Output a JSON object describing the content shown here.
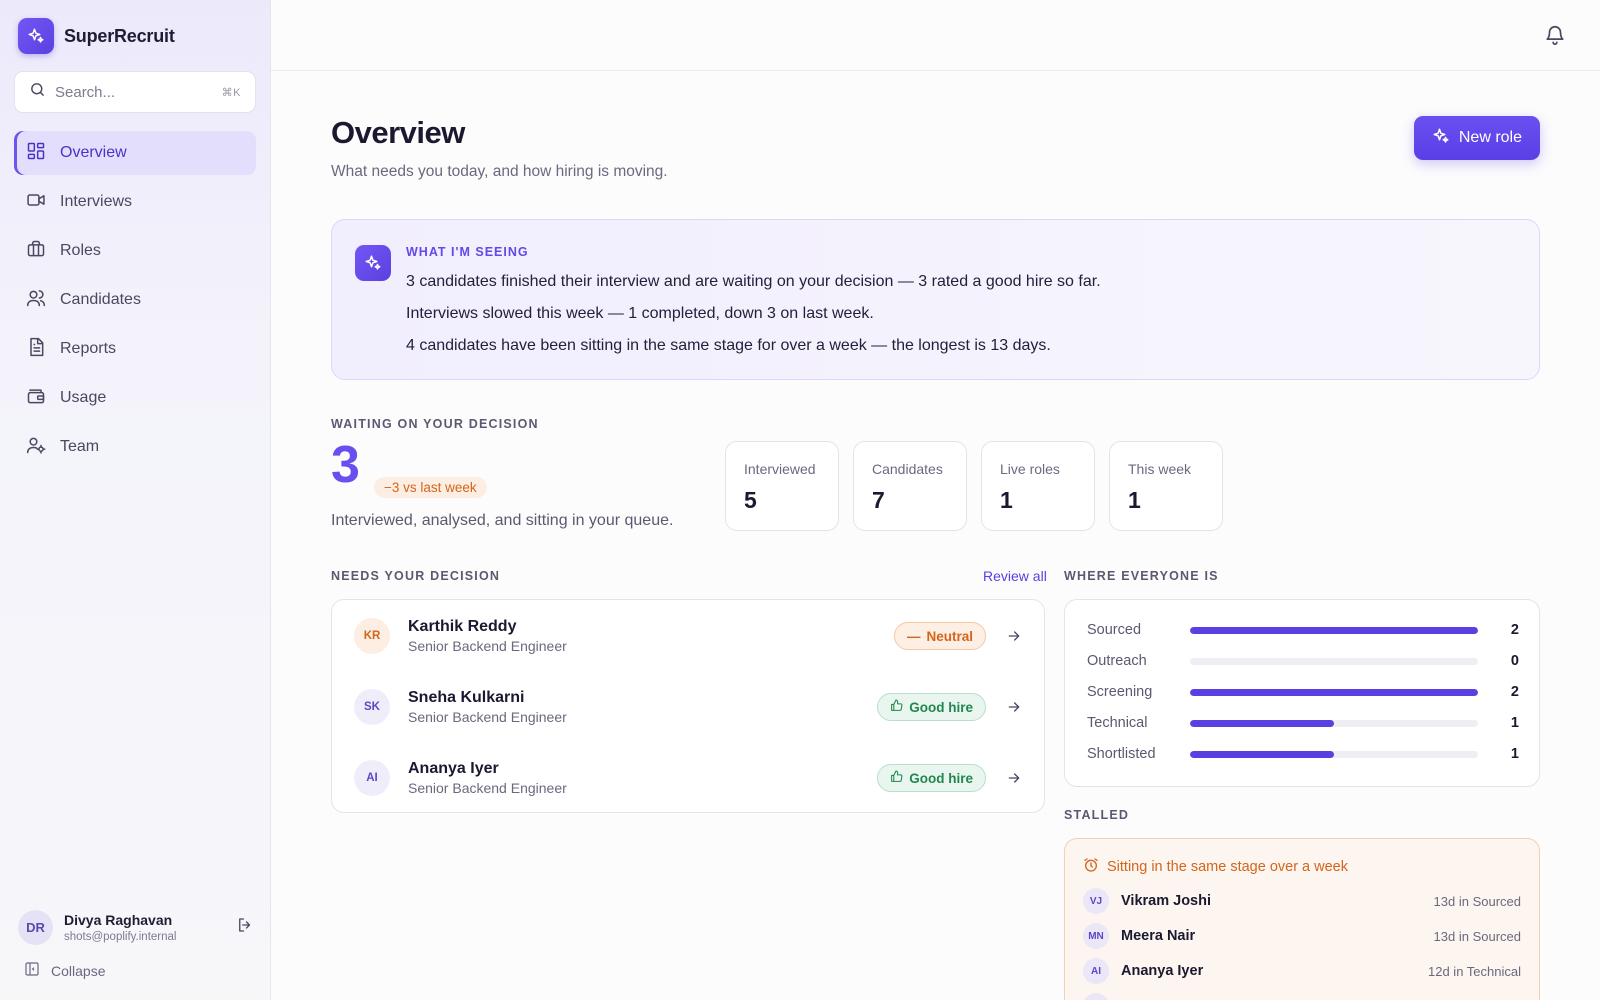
{
  "app": {
    "name": "SuperRecruit"
  },
  "search": {
    "placeholder": "Search...",
    "shortcut": "⌘K"
  },
  "sidebar": {
    "items": [
      {
        "label": "Overview",
        "icon": "grid-icon",
        "active": true
      },
      {
        "label": "Interviews",
        "icon": "video-icon"
      },
      {
        "label": "Roles",
        "icon": "briefcase-icon"
      },
      {
        "label": "Candidates",
        "icon": "users-icon"
      },
      {
        "label": "Reports",
        "icon": "document-icon"
      },
      {
        "label": "Usage",
        "icon": "wallet-icon"
      },
      {
        "label": "Team",
        "icon": "user-gear-icon"
      }
    ],
    "user": {
      "initials": "DR",
      "name": "Divya Raghavan",
      "email": "shots@poplify.internal"
    },
    "collapse_label": "Collapse"
  },
  "page": {
    "title": "Overview",
    "subtitle": "What needs you today, and how hiring is moving.",
    "new_role_label": "New role"
  },
  "insight": {
    "label": "WHAT I'M SEEING",
    "lines": [
      "3 candidates finished their interview and are waiting on your decision — 3 rated a good hire so far.",
      "Interviews slowed this week — 1 completed, down 3 on last week.",
      "4 candidates have been sitting in the same stage for over a week — the longest is 13 days."
    ]
  },
  "waiting": {
    "label": "WAITING ON YOUR DECISION",
    "count": "3",
    "delta": "−3 vs last week",
    "caption": "Interviewed, analysed, and sitting in your queue."
  },
  "stats": [
    {
      "label": "Interviewed",
      "value": "5"
    },
    {
      "label": "Candidates",
      "value": "7"
    },
    {
      "label": "Live roles",
      "value": "1"
    },
    {
      "label": "This week",
      "value": "1"
    }
  ],
  "decisions": {
    "label": "NEEDS YOUR DECISION",
    "review_all": "Review all",
    "candidates": [
      {
        "initials": "KR",
        "name": "Karthik Reddy",
        "role": "Senior Backend Engineer",
        "rating": "Neutral",
        "rating_type": "neutral"
      },
      {
        "initials": "SK",
        "name": "Sneha Kulkarni",
        "role": "Senior Backend Engineer",
        "rating": "Good hire",
        "rating_type": "good"
      },
      {
        "initials": "AI",
        "name": "Ananya Iyer",
        "role": "Senior Backend Engineer",
        "rating": "Good hire",
        "rating_type": "good"
      }
    ]
  },
  "pipeline": {
    "label": "WHERE EVERYONE IS",
    "max": 2,
    "stages": [
      {
        "name": "Sourced",
        "count": 2
      },
      {
        "name": "Outreach",
        "count": 0
      },
      {
        "name": "Screening",
        "count": 2
      },
      {
        "name": "Technical",
        "count": 1
      },
      {
        "name": "Shortlisted",
        "count": 1
      }
    ]
  },
  "stalled": {
    "label": "STALLED",
    "heading": "Sitting in the same stage over a week",
    "items": [
      {
        "initials": "VJ",
        "name": "Vikram Joshi",
        "meta": "13d in Sourced"
      },
      {
        "initials": "MN",
        "name": "Meera Nair",
        "meta": "13d in Sourced"
      },
      {
        "initials": "AI",
        "name": "Ananya Iyer",
        "meta": "12d in Technical"
      }
    ]
  },
  "colors": {
    "accent": "#5b3fe0",
    "warning": "#d3651c",
    "success": "#23864f"
  }
}
